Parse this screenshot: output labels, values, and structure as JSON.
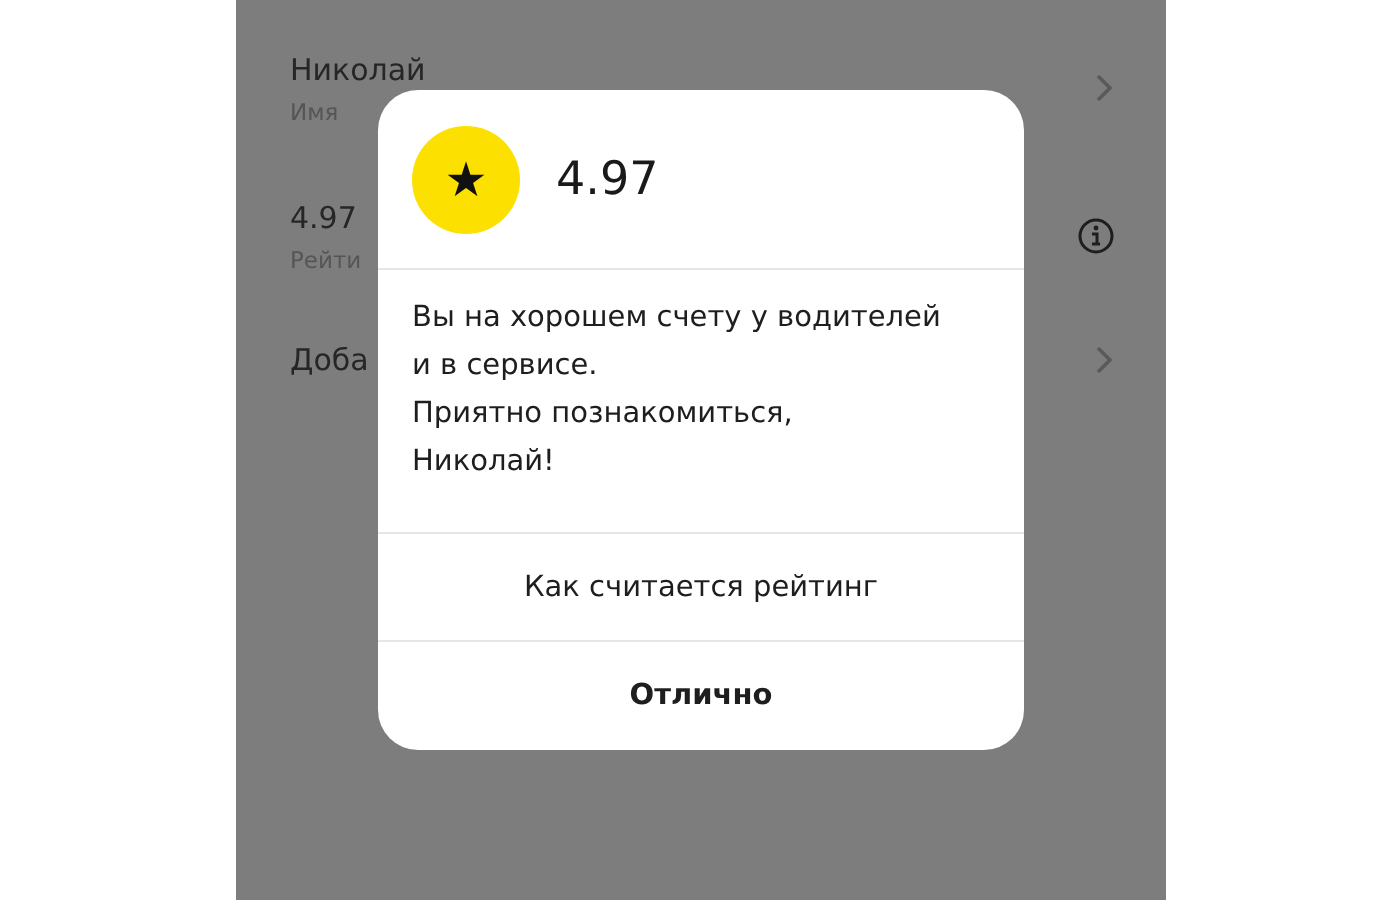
{
  "background_screen": {
    "rows": [
      {
        "kind": "chevron",
        "title": "Николай",
        "subtitle": "Имя"
      },
      {
        "kind": "info",
        "title": "4.97",
        "subtitle": "Рейти"
      },
      {
        "kind": "chevron",
        "title": "Доба"
      }
    ]
  },
  "dialog": {
    "icon": "★",
    "rating": "4.97",
    "message": "Вы на хорошем счету у водителей\nи в сервисе.\nПриятно познакомиться,\nНиколай!",
    "buttons": [
      {
        "label": "Как считается рейтинг",
        "kind": "secondary"
      },
      {
        "label": "Отлично",
        "kind": "primary"
      }
    ]
  }
}
